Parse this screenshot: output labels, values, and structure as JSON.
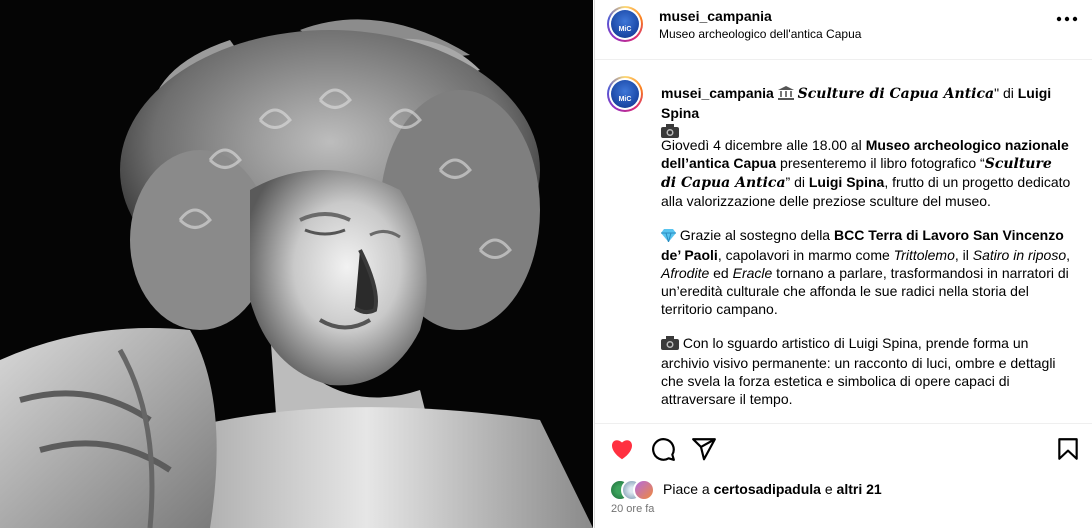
{
  "post": {
    "username": "musei_campania",
    "location": "Museo archeologico dell'antica Capua",
    "avatar_label": "MiC"
  },
  "caption": {
    "username": "musei_campania",
    "title": "Sculture di Capua Antica",
    "title_suffix": "\" di ",
    "author": "Luigi Spina",
    "p1": {
      "t1": "Giovedì 4 dicembre alle 18.00 al ",
      "b1": "Museo archeologico nazionale dell’antica Capua",
      "t2": " presenteremo il libro fotografico “",
      "title": "Sculture di Capua Antica",
      "t3": "” di ",
      "author": "Luigi Spina",
      "t4": ", frutto di un progetto dedicato alla valorizzazione delle preziose sculture del museo."
    },
    "p2": {
      "t1": " Grazie al sostegno della ",
      "b1": "BCC Terra di Lavoro San Vincenzo de’ Paoli",
      "t2": ", capolavori in marmo come ",
      "i1": "Trittolemo",
      "t3": ", il ",
      "i2": "Satiro in riposo",
      "t4": ", ",
      "i3": "Afrodite",
      "t5": " ed ",
      "i4": "Eracle",
      "t6": " tornano a parlare, trasformandosi in narratori di un’eredità culturale che affonda le sue radici nella storia del territorio campano."
    },
    "p3": {
      "t1": " Con lo sguardo artistico di Luigi Spina, prende forma un archivio visivo permanente: un racconto di luci, ombre e dettagli che svela la forza estetica e simbolica di opere capaci di attraversare il tempo."
    }
  },
  "likes": {
    "prefix": "Piace a ",
    "user": "certosadipadula",
    "middle": " e ",
    "others": "altri 21"
  },
  "timestamp": "20 ore fa",
  "colors": {
    "like_red": "#ff3040",
    "divider": "#efefef",
    "muted": "#737373"
  },
  "icons": [
    "more-icon",
    "heart-icon",
    "comment-icon",
    "share-icon",
    "save-icon",
    "museum-icon",
    "camera-icon",
    "gem-icon"
  ]
}
